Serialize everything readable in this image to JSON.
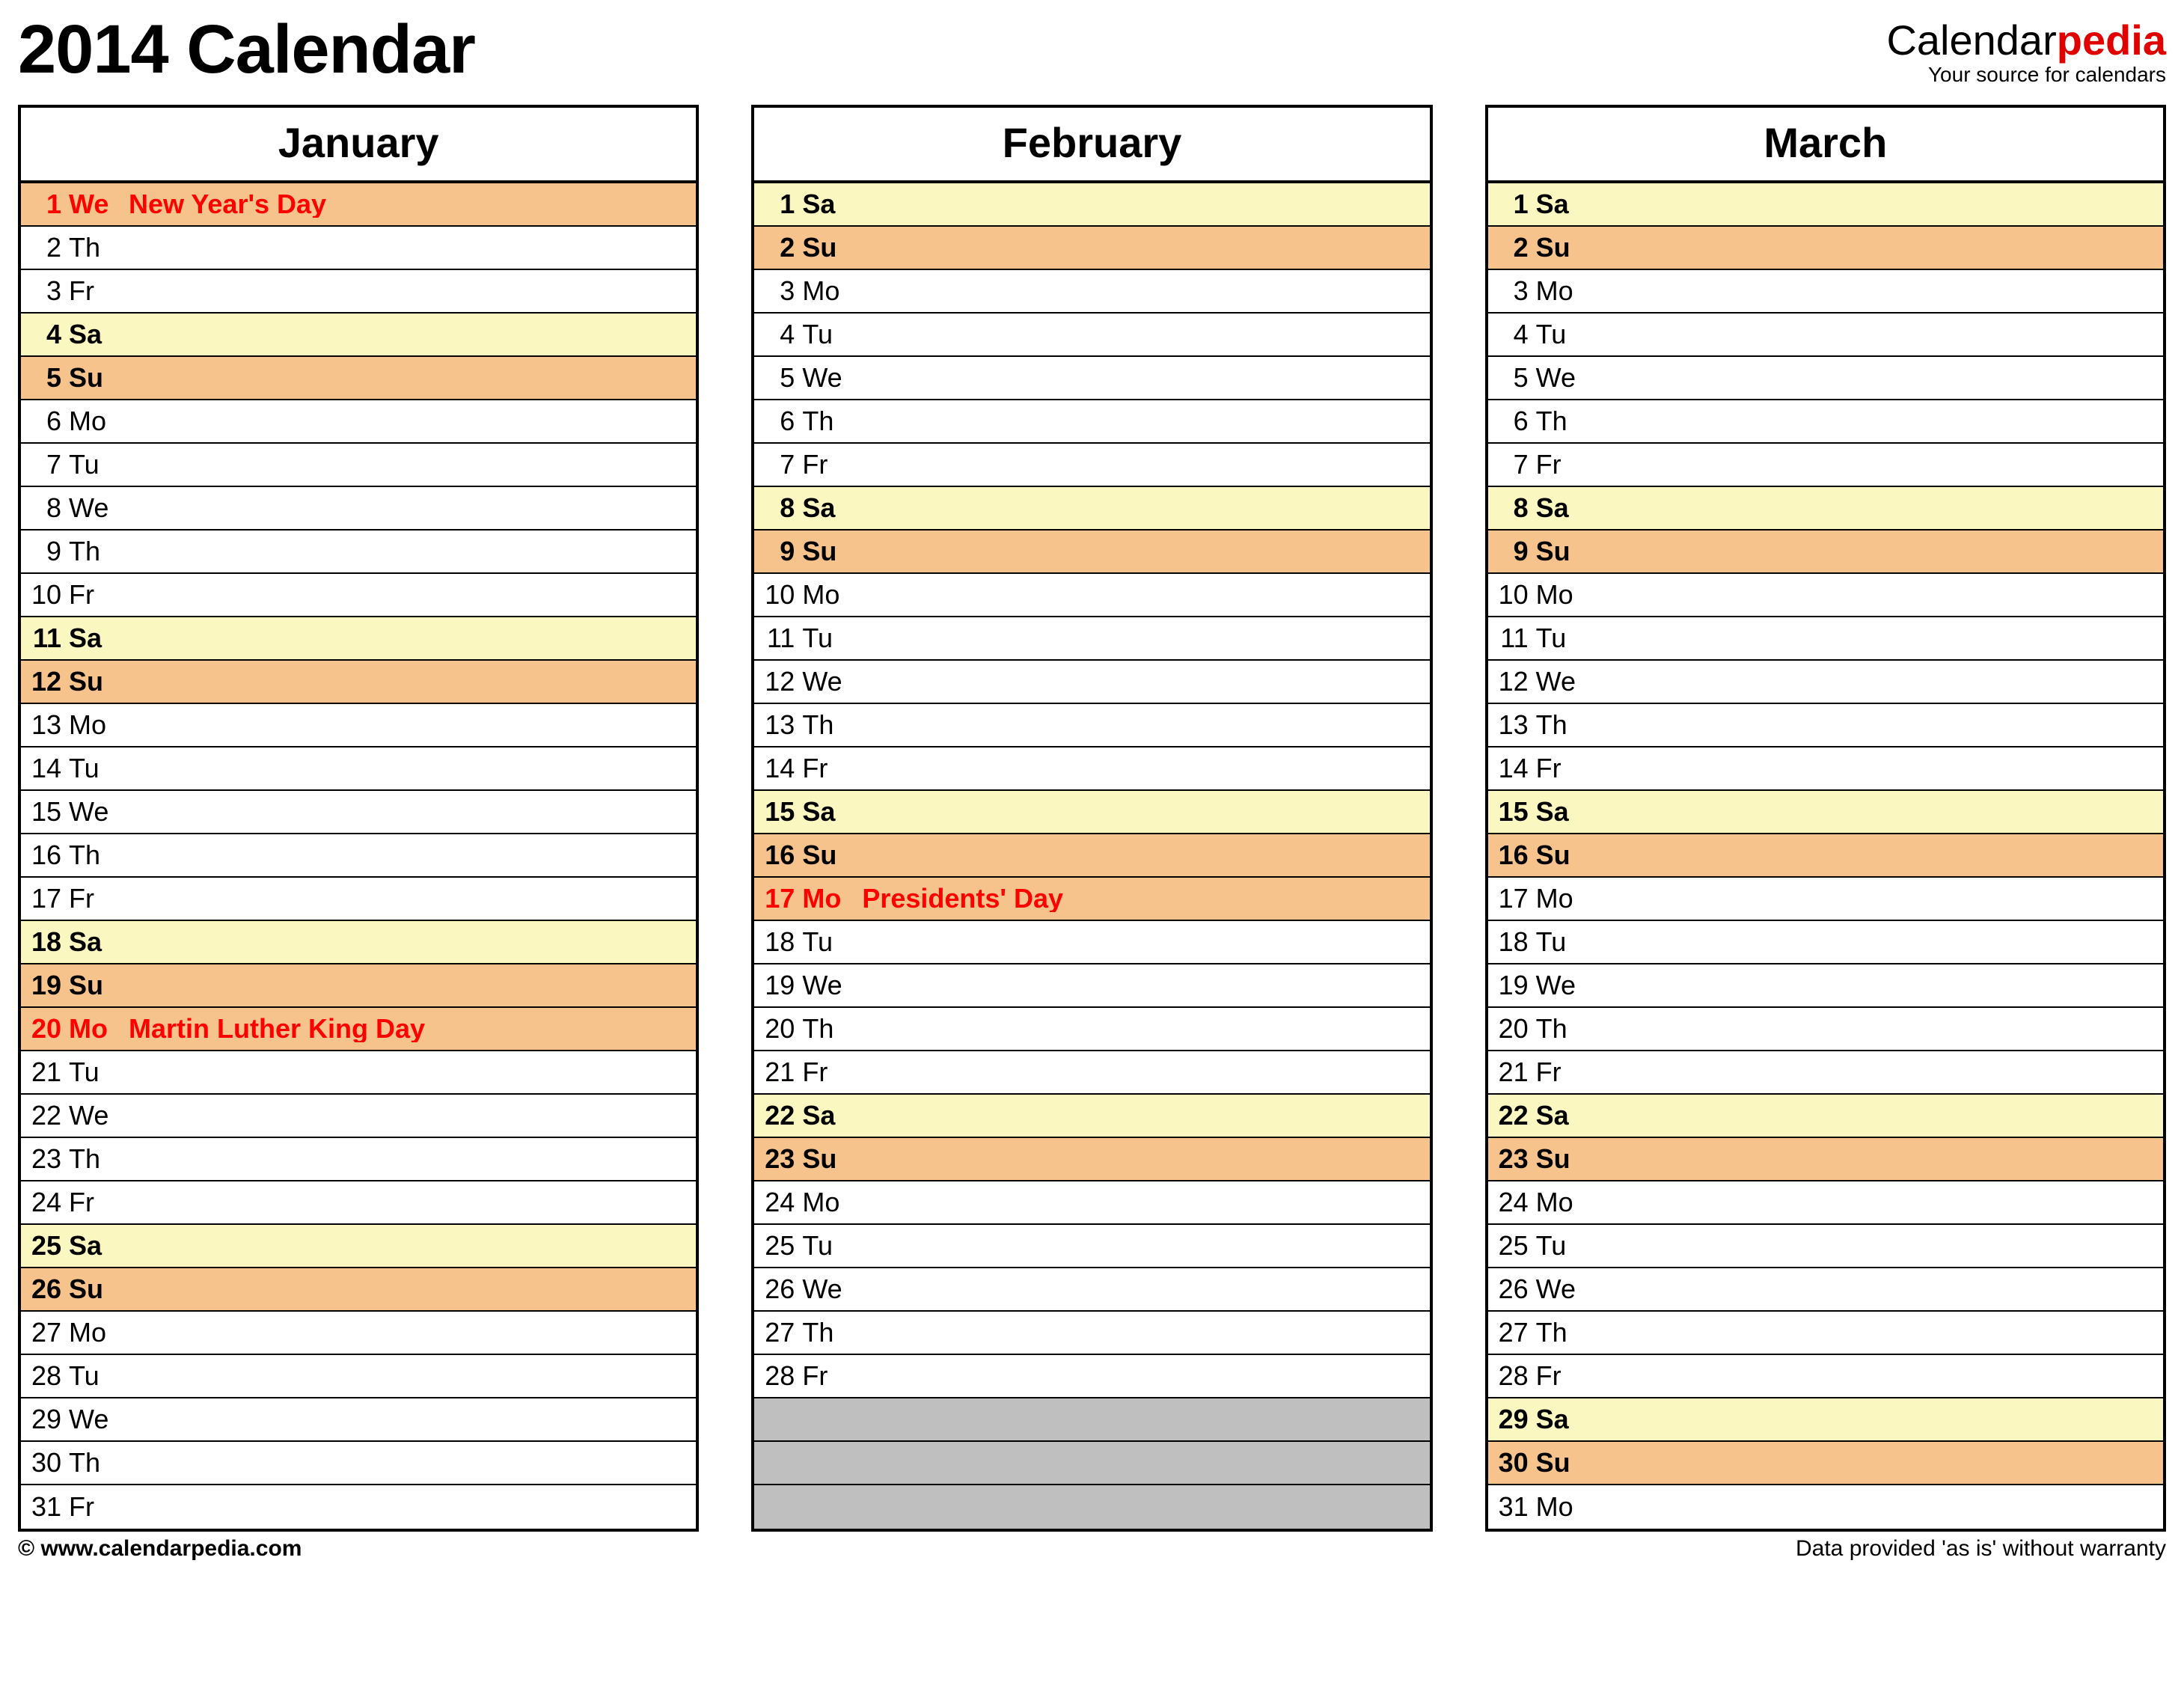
{
  "title": "2014 Calendar",
  "brand": {
    "part1": "Calendar",
    "part2": "pedia",
    "tagline": "Your source for calendars"
  },
  "footer": {
    "left": "© www.calendarpedia.com",
    "right": "Data provided 'as is' without warranty"
  },
  "row_count": 31,
  "months": [
    {
      "name": "January",
      "days": [
        {
          "n": "1",
          "wd": "We",
          "ev": "New Year's Day",
          "cls": "row-hol"
        },
        {
          "n": "2",
          "wd": "Th",
          "ev": "",
          "cls": ""
        },
        {
          "n": "3",
          "wd": "Fr",
          "ev": "",
          "cls": ""
        },
        {
          "n": "4",
          "wd": "Sa",
          "ev": "",
          "cls": "row-sat"
        },
        {
          "n": "5",
          "wd": "Su",
          "ev": "",
          "cls": "row-sun"
        },
        {
          "n": "6",
          "wd": "Mo",
          "ev": "",
          "cls": ""
        },
        {
          "n": "7",
          "wd": "Tu",
          "ev": "",
          "cls": ""
        },
        {
          "n": "8",
          "wd": "We",
          "ev": "",
          "cls": ""
        },
        {
          "n": "9",
          "wd": "Th",
          "ev": "",
          "cls": ""
        },
        {
          "n": "10",
          "wd": "Fr",
          "ev": "",
          "cls": ""
        },
        {
          "n": "11",
          "wd": "Sa",
          "ev": "",
          "cls": "row-sat"
        },
        {
          "n": "12",
          "wd": "Su",
          "ev": "",
          "cls": "row-sun"
        },
        {
          "n": "13",
          "wd": "Mo",
          "ev": "",
          "cls": ""
        },
        {
          "n": "14",
          "wd": "Tu",
          "ev": "",
          "cls": ""
        },
        {
          "n": "15",
          "wd": "We",
          "ev": "",
          "cls": ""
        },
        {
          "n": "16",
          "wd": "Th",
          "ev": "",
          "cls": ""
        },
        {
          "n": "17",
          "wd": "Fr",
          "ev": "",
          "cls": ""
        },
        {
          "n": "18",
          "wd": "Sa",
          "ev": "",
          "cls": "row-sat"
        },
        {
          "n": "19",
          "wd": "Su",
          "ev": "",
          "cls": "row-sun"
        },
        {
          "n": "20",
          "wd": "Mo",
          "ev": "Martin Luther King Day",
          "cls": "row-hol"
        },
        {
          "n": "21",
          "wd": "Tu",
          "ev": "",
          "cls": ""
        },
        {
          "n": "22",
          "wd": "We",
          "ev": "",
          "cls": ""
        },
        {
          "n": "23",
          "wd": "Th",
          "ev": "",
          "cls": ""
        },
        {
          "n": "24",
          "wd": "Fr",
          "ev": "",
          "cls": ""
        },
        {
          "n": "25",
          "wd": "Sa",
          "ev": "",
          "cls": "row-sat"
        },
        {
          "n": "26",
          "wd": "Su",
          "ev": "",
          "cls": "row-sun"
        },
        {
          "n": "27",
          "wd": "Mo",
          "ev": "",
          "cls": ""
        },
        {
          "n": "28",
          "wd": "Tu",
          "ev": "",
          "cls": ""
        },
        {
          "n": "29",
          "wd": "We",
          "ev": "",
          "cls": ""
        },
        {
          "n": "30",
          "wd": "Th",
          "ev": "",
          "cls": ""
        },
        {
          "n": "31",
          "wd": "Fr",
          "ev": "",
          "cls": ""
        }
      ]
    },
    {
      "name": "February",
      "days": [
        {
          "n": "1",
          "wd": "Sa",
          "ev": "",
          "cls": "row-sat"
        },
        {
          "n": "2",
          "wd": "Su",
          "ev": "",
          "cls": "row-sun"
        },
        {
          "n": "3",
          "wd": "Mo",
          "ev": "",
          "cls": ""
        },
        {
          "n": "4",
          "wd": "Tu",
          "ev": "",
          "cls": ""
        },
        {
          "n": "5",
          "wd": "We",
          "ev": "",
          "cls": ""
        },
        {
          "n": "6",
          "wd": "Th",
          "ev": "",
          "cls": ""
        },
        {
          "n": "7",
          "wd": "Fr",
          "ev": "",
          "cls": ""
        },
        {
          "n": "8",
          "wd": "Sa",
          "ev": "",
          "cls": "row-sat"
        },
        {
          "n": "9",
          "wd": "Su",
          "ev": "",
          "cls": "row-sun"
        },
        {
          "n": "10",
          "wd": "Mo",
          "ev": "",
          "cls": ""
        },
        {
          "n": "11",
          "wd": "Tu",
          "ev": "",
          "cls": ""
        },
        {
          "n": "12",
          "wd": "We",
          "ev": "",
          "cls": ""
        },
        {
          "n": "13",
          "wd": "Th",
          "ev": "",
          "cls": ""
        },
        {
          "n": "14",
          "wd": "Fr",
          "ev": "",
          "cls": ""
        },
        {
          "n": "15",
          "wd": "Sa",
          "ev": "",
          "cls": "row-sat"
        },
        {
          "n": "16",
          "wd": "Su",
          "ev": "",
          "cls": "row-sun"
        },
        {
          "n": "17",
          "wd": "Mo",
          "ev": "Presidents' Day",
          "cls": "row-hol"
        },
        {
          "n": "18",
          "wd": "Tu",
          "ev": "",
          "cls": ""
        },
        {
          "n": "19",
          "wd": "We",
          "ev": "",
          "cls": ""
        },
        {
          "n": "20",
          "wd": "Th",
          "ev": "",
          "cls": ""
        },
        {
          "n": "21",
          "wd": "Fr",
          "ev": "",
          "cls": ""
        },
        {
          "n": "22",
          "wd": "Sa",
          "ev": "",
          "cls": "row-sat"
        },
        {
          "n": "23",
          "wd": "Su",
          "ev": "",
          "cls": "row-sun"
        },
        {
          "n": "24",
          "wd": "Mo",
          "ev": "",
          "cls": ""
        },
        {
          "n": "25",
          "wd": "Tu",
          "ev": "",
          "cls": ""
        },
        {
          "n": "26",
          "wd": "We",
          "ev": "",
          "cls": ""
        },
        {
          "n": "27",
          "wd": "Th",
          "ev": "",
          "cls": ""
        },
        {
          "n": "28",
          "wd": "Fr",
          "ev": "",
          "cls": ""
        }
      ]
    },
    {
      "name": "March",
      "days": [
        {
          "n": "1",
          "wd": "Sa",
          "ev": "",
          "cls": "row-sat"
        },
        {
          "n": "2",
          "wd": "Su",
          "ev": "",
          "cls": "row-sun"
        },
        {
          "n": "3",
          "wd": "Mo",
          "ev": "",
          "cls": ""
        },
        {
          "n": "4",
          "wd": "Tu",
          "ev": "",
          "cls": ""
        },
        {
          "n": "5",
          "wd": "We",
          "ev": "",
          "cls": ""
        },
        {
          "n": "6",
          "wd": "Th",
          "ev": "",
          "cls": ""
        },
        {
          "n": "7",
          "wd": "Fr",
          "ev": "",
          "cls": ""
        },
        {
          "n": "8",
          "wd": "Sa",
          "ev": "",
          "cls": "row-sat"
        },
        {
          "n": "9",
          "wd": "Su",
          "ev": "",
          "cls": "row-sun"
        },
        {
          "n": "10",
          "wd": "Mo",
          "ev": "",
          "cls": ""
        },
        {
          "n": "11",
          "wd": "Tu",
          "ev": "",
          "cls": ""
        },
        {
          "n": "12",
          "wd": "We",
          "ev": "",
          "cls": ""
        },
        {
          "n": "13",
          "wd": "Th",
          "ev": "",
          "cls": ""
        },
        {
          "n": "14",
          "wd": "Fr",
          "ev": "",
          "cls": ""
        },
        {
          "n": "15",
          "wd": "Sa",
          "ev": "",
          "cls": "row-sat"
        },
        {
          "n": "16",
          "wd": "Su",
          "ev": "",
          "cls": "row-sun"
        },
        {
          "n": "17",
          "wd": "Mo",
          "ev": "",
          "cls": ""
        },
        {
          "n": "18",
          "wd": "Tu",
          "ev": "",
          "cls": ""
        },
        {
          "n": "19",
          "wd": "We",
          "ev": "",
          "cls": ""
        },
        {
          "n": "20",
          "wd": "Th",
          "ev": "",
          "cls": ""
        },
        {
          "n": "21",
          "wd": "Fr",
          "ev": "",
          "cls": ""
        },
        {
          "n": "22",
          "wd": "Sa",
          "ev": "",
          "cls": "row-sat"
        },
        {
          "n": "23",
          "wd": "Su",
          "ev": "",
          "cls": "row-sun"
        },
        {
          "n": "24",
          "wd": "Mo",
          "ev": "",
          "cls": ""
        },
        {
          "n": "25",
          "wd": "Tu",
          "ev": "",
          "cls": ""
        },
        {
          "n": "26",
          "wd": "We",
          "ev": "",
          "cls": ""
        },
        {
          "n": "27",
          "wd": "Th",
          "ev": "",
          "cls": ""
        },
        {
          "n": "28",
          "wd": "Fr",
          "ev": "",
          "cls": ""
        },
        {
          "n": "29",
          "wd": "Sa",
          "ev": "",
          "cls": "row-sat"
        },
        {
          "n": "30",
          "wd": "Su",
          "ev": "",
          "cls": "row-sun"
        },
        {
          "n": "31",
          "wd": "Mo",
          "ev": "",
          "cls": ""
        }
      ]
    }
  ]
}
